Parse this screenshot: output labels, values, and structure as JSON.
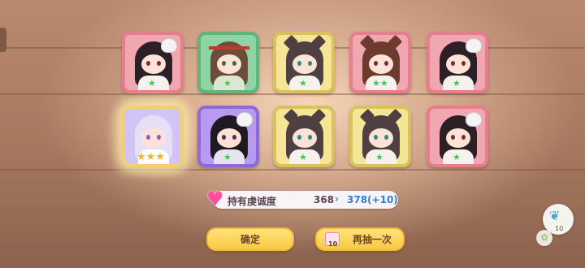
{
  "results": {
    "row1": [
      {
        "color": "pink",
        "hair": "#2c1f25",
        "accessory": "skull",
        "stars": "★"
      },
      {
        "color": "green",
        "hair": "#6e4c3a",
        "accessory": "headband",
        "stars": "★"
      },
      {
        "color": "yellow",
        "hair": "#4e4040",
        "accessory": "wolf-ears",
        "stars": "★"
      },
      {
        "color": "pink",
        "hair": "#6d3b2e",
        "accessory": "wolf-ears",
        "stars": "★★"
      },
      {
        "color": "pink",
        "hair": "#2c1f25",
        "accessory": "skull",
        "stars": "★"
      }
    ],
    "row2": [
      {
        "color": "lav",
        "hair": "#e6e0f7",
        "accessory": "halo",
        "stars": "★★★"
      },
      {
        "color": "purple",
        "hair": "#1f1a22",
        "accessory": "skull",
        "stars": "★"
      },
      {
        "color": "yellow",
        "hair": "#4e4040",
        "accessory": "wolf-ears",
        "stars": "★"
      },
      {
        "color": "yellow",
        "hair": "#4e4040",
        "accessory": "wolf-ears",
        "stars": "★"
      },
      {
        "color": "pink",
        "hair": "#2c1f25",
        "accessory": "skull",
        "stars": "★"
      }
    ]
  },
  "devotion": {
    "label": "持有虔诚度",
    "current": "368",
    "arrow": "›",
    "new_value": "378(+10)"
  },
  "buttons": {
    "confirm": "确定",
    "again": "再抽一次",
    "ticket_count": "10"
  },
  "side": {
    "count": "10"
  },
  "colors": {
    "accent": "#f9c944",
    "heart": "#ff4f9e",
    "highlight": "#2f7fd6"
  }
}
